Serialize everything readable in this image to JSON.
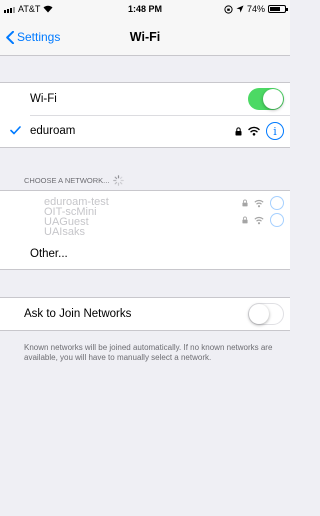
{
  "status_bar": {
    "carrier": "AT&T",
    "time": "1:48 PM",
    "battery": "74%"
  },
  "nav": {
    "back_label": "Settings",
    "title": "Wi-Fi"
  },
  "wifi": {
    "label": "Wi-Fi",
    "enabled": true
  },
  "connected": {
    "network": "eduroam"
  },
  "choose": {
    "header": "CHOOSE A NETWORK...",
    "partial_networks": [
      "eduroam-test",
      "OIT-scMini",
      "UAGuest",
      "UAIsaks"
    ],
    "other_label": "Other..."
  },
  "ask_join": {
    "label": "Ask to Join Networks",
    "enabled": false,
    "description": "Known networks will be joined automatically. If no known networks are available, you will have to manually select a network."
  },
  "colors": {
    "accent": "#007aff",
    "toggle_on": "#4cd964"
  }
}
